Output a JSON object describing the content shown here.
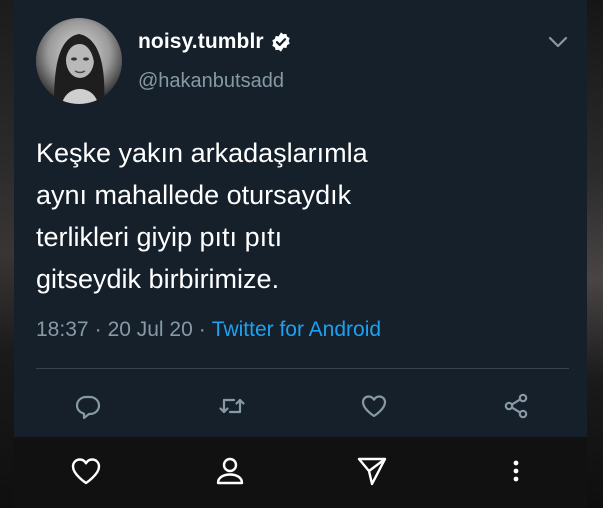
{
  "tweet": {
    "display_name": "noisy.tumblr",
    "handle": "@hakanbutsadd",
    "text": "Keşke yakın arkadaşlarımla\naynı mahallede otursaydık\nterlikleri giyip pıtı pıtı\ngitseydik birbirimize.",
    "time": "18:37",
    "separator": "·",
    "date": "20 Jul 20",
    "source": "Twitter for Android",
    "verified": true
  },
  "icons": {
    "more": "chevron-down-icon",
    "verified": "verified-badge-icon",
    "reply": "reply-icon",
    "retweet": "retweet-icon",
    "like": "heart-icon",
    "share": "share-icon"
  },
  "bottom_nav": {
    "like": "heart-icon",
    "profile": "profile-icon",
    "send": "send-icon",
    "menu": "more-vertical-icon"
  },
  "colors": {
    "card_background": "#15202b",
    "text": "#ffffff",
    "secondary_text": "#8899a6",
    "link": "#1da1f2",
    "divider": "#38444d",
    "bottom_bar": "#111111"
  }
}
